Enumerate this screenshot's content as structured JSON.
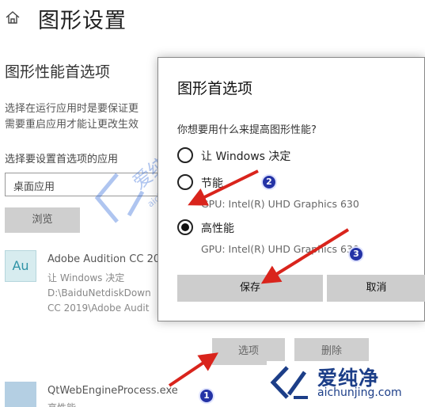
{
  "page": {
    "title": "图形设置",
    "section_title": "图形性能首选项",
    "description_line1": "选择在运行应用时是要保证更",
    "description_line2": "需要重启应用才能让更改生效",
    "choose_label": "选择要设置首选项的应用",
    "app_type_value": "桌面应用",
    "browse_label": "浏览"
  },
  "apps": [
    {
      "icon_text": "Au",
      "name": "Adobe Audition CC 20",
      "preference": "让 Windows 决定",
      "path_line1": "D:\\BaiduNetdiskDown",
      "path_line2": "CC 2019\\Adobe Audit"
    },
    {
      "name": "QtWebEngineProcess.exe",
      "preference": "高性能"
    }
  ],
  "app_actions": {
    "options_label": "选项",
    "delete_label": "删除"
  },
  "dialog": {
    "title": "图形首选项",
    "question": "你想要用什么来提高图形性能?",
    "options": [
      {
        "label": "让 Windows 决定",
        "checked": false
      },
      {
        "label": "节能",
        "checked": false,
        "gpu": "GPU: Intel(R) UHD Graphics 630"
      },
      {
        "label": "高性能",
        "checked": true,
        "gpu": "GPU: Intel(R) UHD Graphics 630"
      }
    ],
    "save_label": "保存",
    "cancel_label": "取消"
  },
  "annotations": {
    "badges": [
      "1",
      "2",
      "3"
    ],
    "arrow_color": "#d9241c"
  },
  "watermark": {
    "text": "爱纯净",
    "url": "aichunjing.com"
  }
}
